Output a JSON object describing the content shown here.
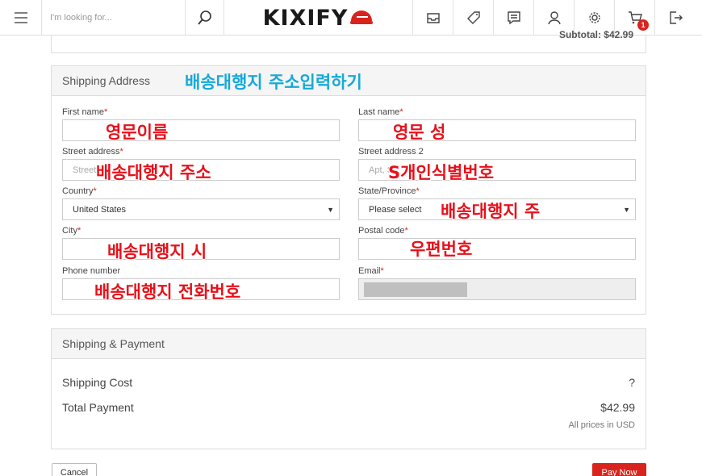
{
  "header": {
    "search_placeholder": "I'm looking for...",
    "logo_text": "KIXIFY",
    "cart_count": "1"
  },
  "summary": {
    "subtotal_peek": "Subtotal: $42.99"
  },
  "address": {
    "title": "Shipping Address",
    "first_name_label": "First name",
    "last_name_label": "Last name",
    "street_label": "Street address",
    "street_placeholder": "Street",
    "street2_label": "Street address 2",
    "street2_placeholder": "Apt, S",
    "country_label": "Country",
    "country_value": "United States",
    "state_label": "State/Province",
    "state_value": "Please select",
    "city_label": "City",
    "postal_label": "Postal code",
    "phone_label": "Phone number",
    "email_label": "Email",
    "required_mark": "*"
  },
  "annotations": {
    "section": "배송대행지 주소입력하기",
    "first_name": "영문이름",
    "last_name": "영문 성",
    "street": "배송대행지 주소",
    "street2": "S개인식별번호",
    "state": "배송대행지 주",
    "city": "배송대행지 시",
    "postal": "우편번호",
    "phone": "배송대행지 전화번호"
  },
  "payment": {
    "title": "Shipping & Payment",
    "shipping_cost_label": "Shipping Cost",
    "shipping_cost_value": "?",
    "total_label": "Total Payment",
    "total_value": "$42.99",
    "currency_note": "All prices in USD"
  },
  "actions": {
    "cancel": "Cancel",
    "pay_now": "Pay Now"
  }
}
